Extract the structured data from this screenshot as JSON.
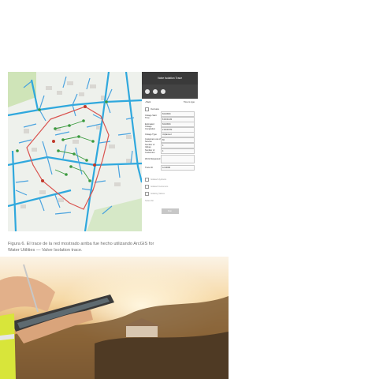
{
  "figure": {
    "caption_line1": "Figura 6. El trace de la red mostrado arriba fue hecho utilizando ArcGIS for",
    "caption_line2": "Water Utilities — Valve Isolation trace."
  },
  "panel": {
    "title": "Valve Isolation Trace",
    "back_label": "‹ Back",
    "next_label": "Time to type",
    "overview_label": "Overview",
    "fields": [
      {
        "label": "Outage Start Time",
        "value": "6/13/2016",
        "value2": "8:00:00 AM"
      },
      {
        "label": "Estimated Outage Completion",
        "value": "6/13/2016",
        "value2": "2:00:00 PM"
      },
      {
        "label": "Outage Type",
        "value": "Unplanned"
      },
      {
        "label": "Customers out of Service",
        "value": "66"
      },
      {
        "label": "Number of Valves",
        "value": "4"
      },
      {
        "label": "Number of Customers",
        "value": "4"
      },
      {
        "label": "Work Requested",
        "value": ""
      },
      {
        "label": "Trace ID",
        "value": "12-40003"
      }
    ],
    "options": [
      "Isolated Hydrants",
      "Isolated Customers",
      "Isolating Valves",
      "Select All"
    ],
    "run_label": "Run"
  },
  "colors": {
    "pipe": "#2fa8dd",
    "service": "#4aa3df",
    "boundary": "#d9534f",
    "hydrant": "#3a9a3e",
    "panel_header": "#3a3a3a",
    "caption": "#6d6d6d"
  }
}
